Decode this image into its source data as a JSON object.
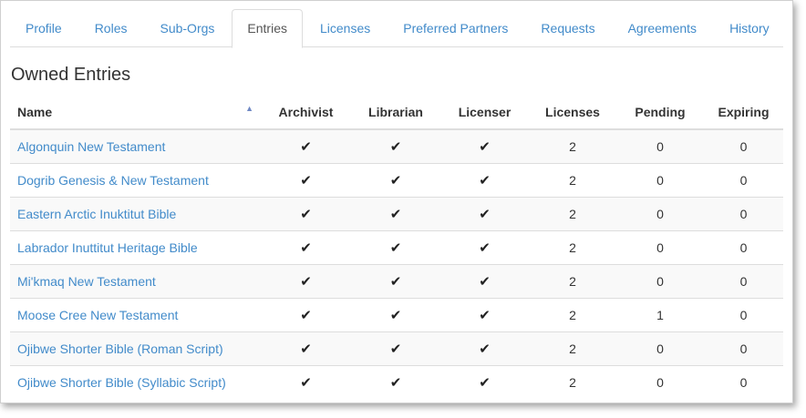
{
  "tabs": [
    {
      "label": "Profile",
      "active": false
    },
    {
      "label": "Roles",
      "active": false
    },
    {
      "label": "Sub-Orgs",
      "active": false
    },
    {
      "label": "Entries",
      "active": true
    },
    {
      "label": "Licenses",
      "active": false
    },
    {
      "label": "Preferred Partners",
      "active": false
    },
    {
      "label": "Requests",
      "active": false
    },
    {
      "label": "Agreements",
      "active": false
    },
    {
      "label": "History",
      "active": false
    }
  ],
  "section_title": "Owned Entries",
  "table": {
    "sort": {
      "column": "Name",
      "direction": "ascending",
      "icon": "triangle-up-icon"
    },
    "columns": [
      "Name",
      "Archivist",
      "Librarian",
      "Licenser",
      "Licenses",
      "Pending",
      "Expiring"
    ],
    "check_glyph": "✔",
    "rows": [
      {
        "name": "Algonquin New Testament",
        "archivist": true,
        "librarian": true,
        "licenser": true,
        "licenses": "2",
        "pending": "0",
        "expiring": "0"
      },
      {
        "name": "Dogrib Genesis & New Testament",
        "archivist": true,
        "librarian": true,
        "licenser": true,
        "licenses": "2",
        "pending": "0",
        "expiring": "0"
      },
      {
        "name": "Eastern Arctic Inuktitut Bible",
        "archivist": true,
        "librarian": true,
        "licenser": true,
        "licenses": "2",
        "pending": "0",
        "expiring": "0"
      },
      {
        "name": "Labrador Inuttitut Heritage Bible",
        "archivist": true,
        "librarian": true,
        "licenser": true,
        "licenses": "2",
        "pending": "0",
        "expiring": "0"
      },
      {
        "name": "Mi'kmaq New Testament",
        "archivist": true,
        "librarian": true,
        "licenser": true,
        "licenses": "2",
        "pending": "0",
        "expiring": "0"
      },
      {
        "name": "Moose Cree New Testament",
        "archivist": true,
        "librarian": true,
        "licenser": true,
        "licenses": "2",
        "pending": "1",
        "expiring": "0"
      },
      {
        "name": "Ojibwe Shorter Bible (Roman Script)",
        "archivist": true,
        "librarian": true,
        "licenser": true,
        "licenses": "2",
        "pending": "0",
        "expiring": "0"
      },
      {
        "name": "Ojibwe Shorter Bible (Syllabic Script)",
        "archivist": true,
        "librarian": true,
        "licenser": true,
        "licenses": "2",
        "pending": "0",
        "expiring": "0"
      }
    ]
  },
  "colors": {
    "link": "#428bca",
    "active_tab_text": "#555555",
    "border": "#dddddd",
    "stripe": "#f9f9f9",
    "sort_icon": "#6f88c4"
  }
}
